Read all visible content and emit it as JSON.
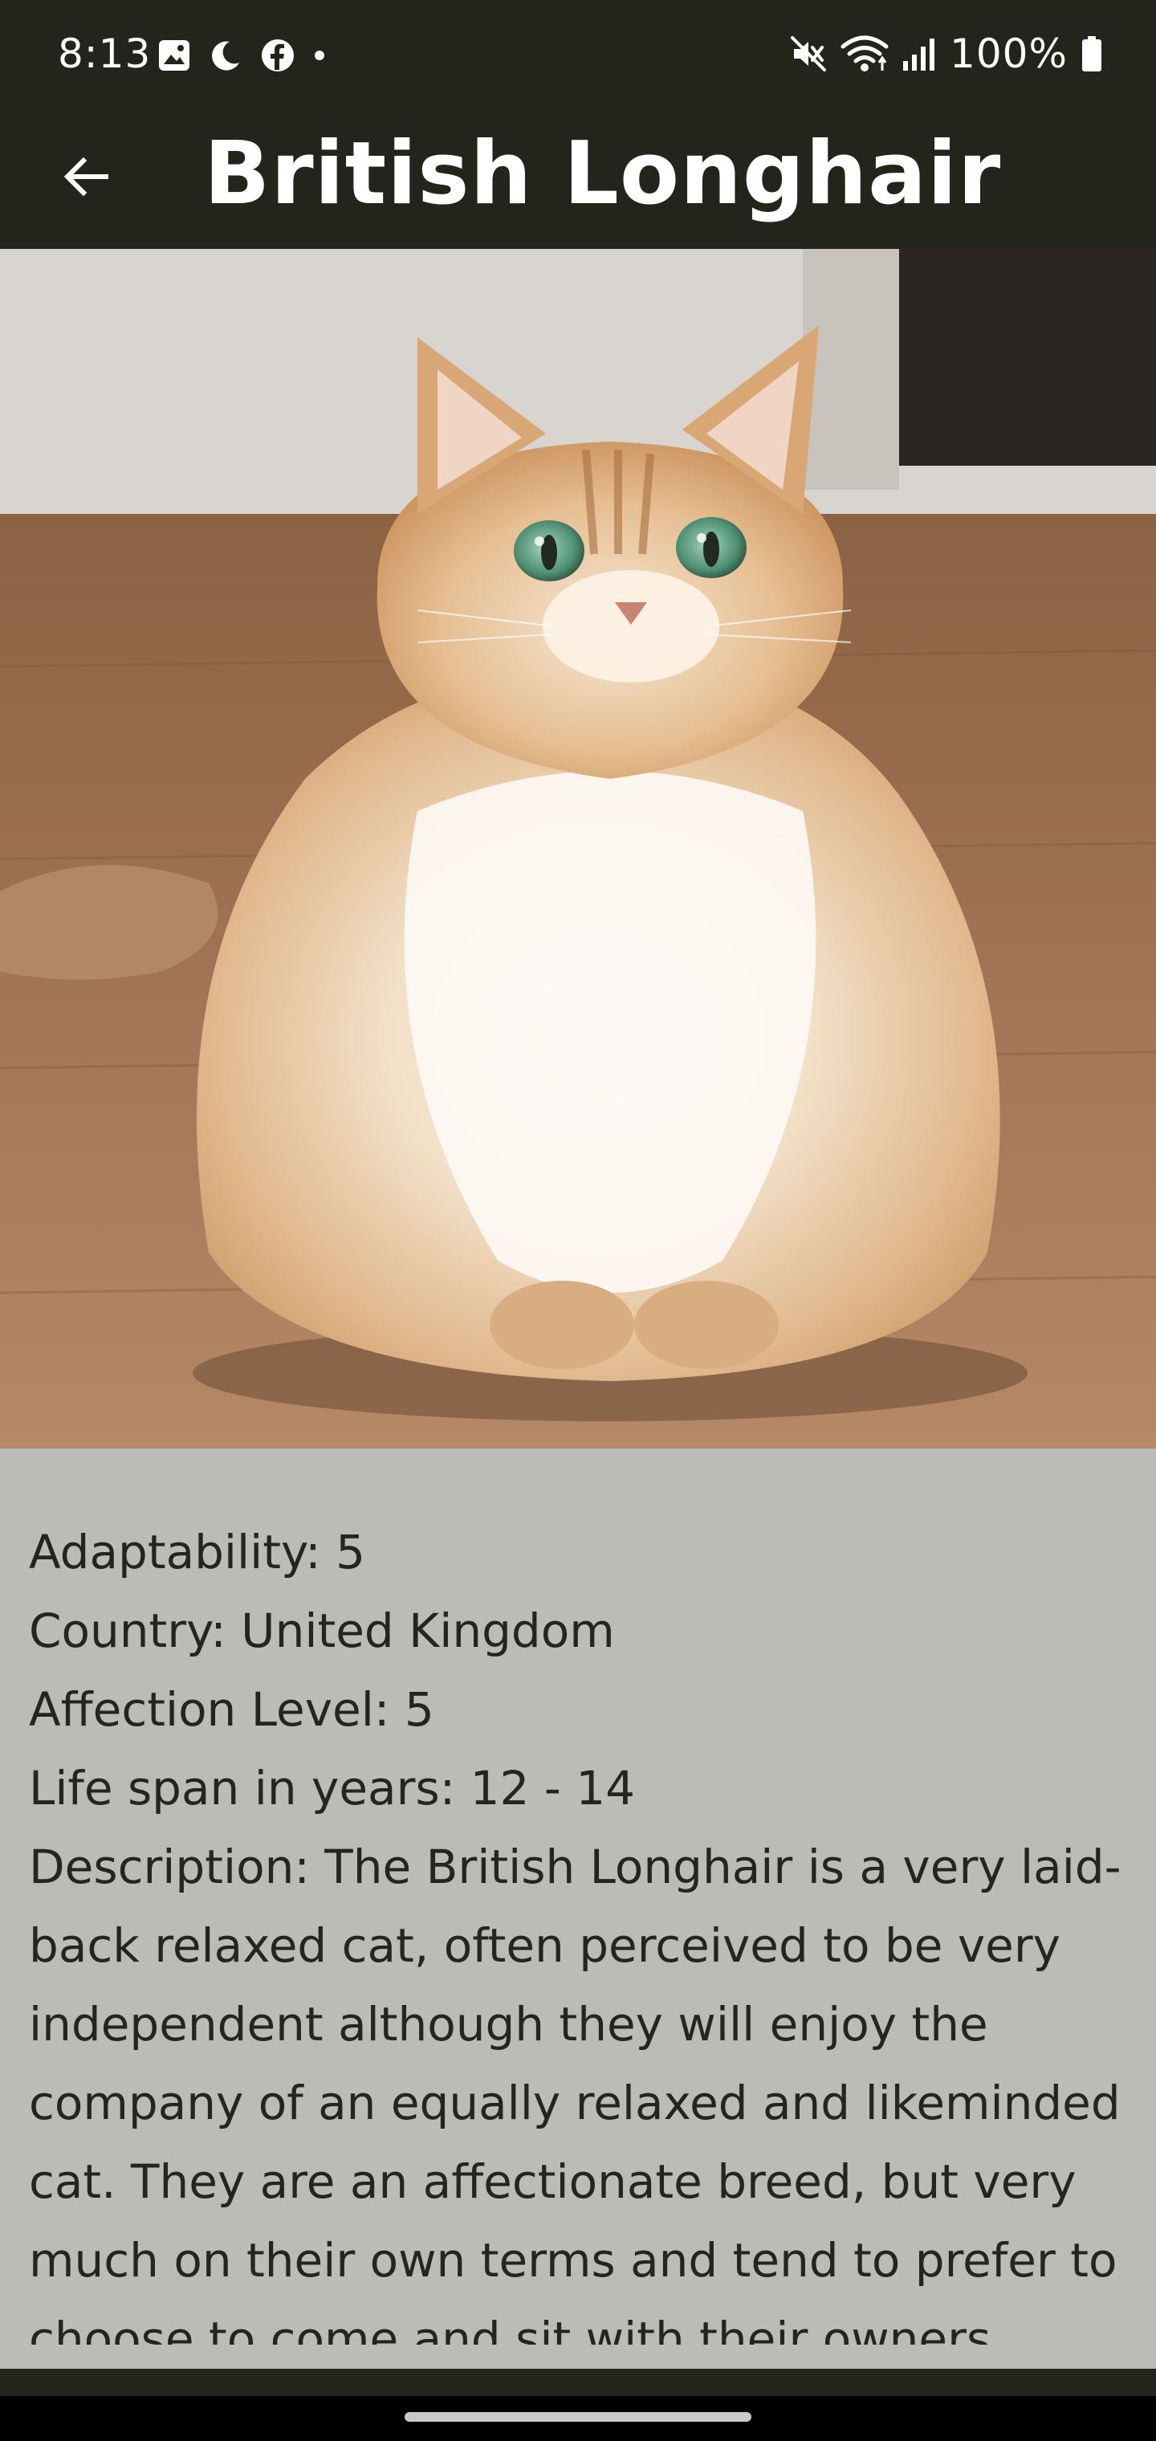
{
  "status_bar": {
    "time": "8:13",
    "battery": "100%",
    "icons_left": [
      "gallery-icon",
      "moon-icon",
      "facebook-icon",
      "dot-icon"
    ],
    "icons_right": [
      "mute-icon",
      "wifi-icon",
      "signal-icon",
      "battery-icon"
    ]
  },
  "app_bar": {
    "title": "British Longhair",
    "back_icon": "arrow-left-icon",
    "background": "#23251d"
  },
  "hero": {
    "alt": "British Longhair"
  },
  "details": {
    "adaptability": "Adaptability: 5",
    "country": "Country: United Kingdom",
    "affection": "Affection Level: 5",
    "life_span": "Life span in years: 12 - 14",
    "description": "Description: The British Longhair is a very laid-back relaxed cat, often perceived to be very independent although they will enjoy the company of an equally relaxed and likeminded cat. They are an affectionate breed, but very much on their own terms and tend to prefer to choose to come and sit with their owners",
    "background": "#bbbbb7",
    "text_color": "#24251f"
  },
  "colors": {
    "bar": "#23251d",
    "panel": "#bbbbb7",
    "nav": "#000000"
  }
}
